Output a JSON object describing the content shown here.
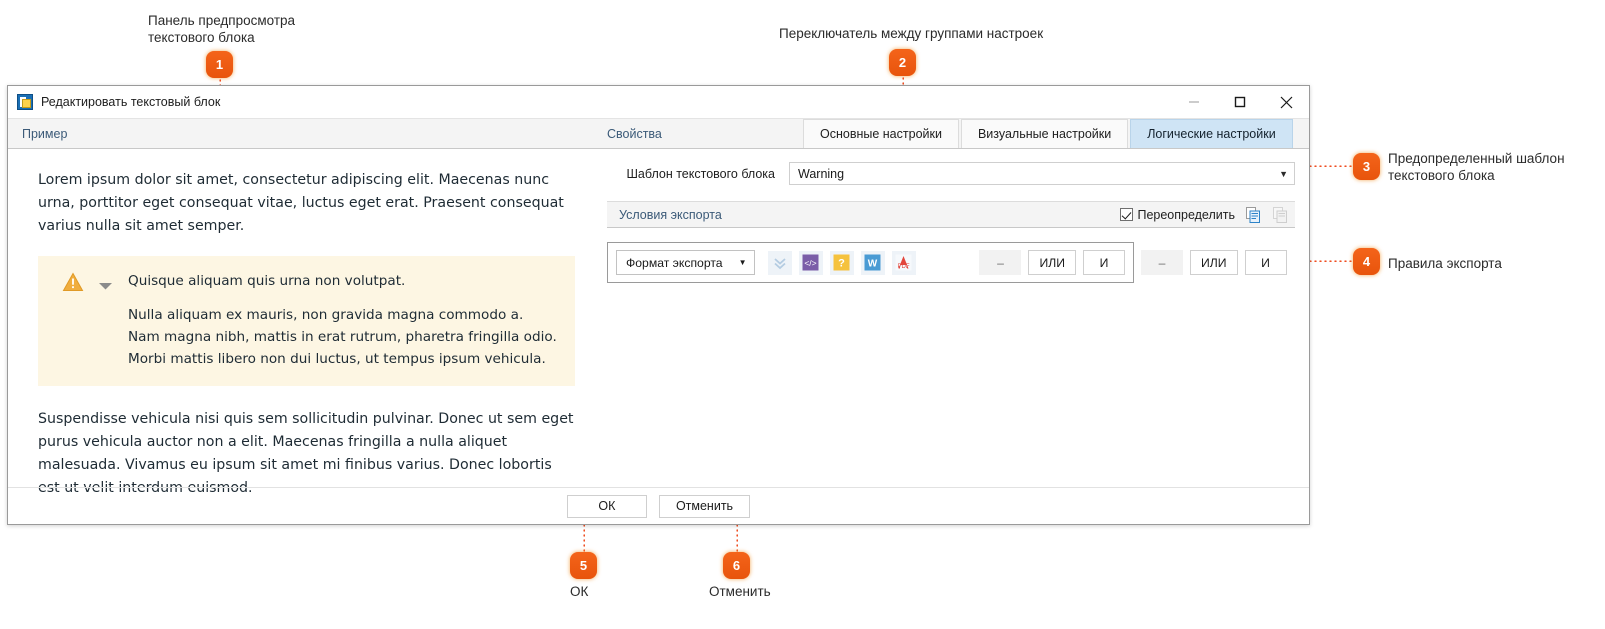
{
  "annotations": [
    {
      "n": "1",
      "label": "Панель предпросмотра\nтекстового блока"
    },
    {
      "n": "2",
      "label": "Переключатель между группами настроек"
    },
    {
      "n": "3",
      "label": "Предопределенный шаблон\nтекстового блока"
    },
    {
      "n": "4",
      "label": "Правила экспорта"
    },
    {
      "n": "5",
      "label": "ОК"
    },
    {
      "n": "6",
      "label": "Отменить"
    }
  ],
  "window": {
    "title": "Редактировать текстовый блок",
    "icon": "text-block-icon",
    "controls": {
      "minimize": "minimize-icon",
      "maximize": "maximize-icon",
      "close": "close-icon"
    }
  },
  "preview": {
    "header": "Пример",
    "paragraph1": "Lorem ipsum dolor sit amet, consectetur adipiscing elit. Maecenas nunc urna, porttitor eget consequat vitae, luctus eget erat. Praesent consequat varius nulla sit amet semper.",
    "callout": {
      "icon": "warning-triangle-icon",
      "toggle": "chevron-down-icon",
      "heading": "Quisque aliquam quis urna non volutpat.",
      "body": "Nulla aliquam ex mauris, non gravida magna commodo a. Nam magna nibh, mattis in erat rutrum, pharetra fringilla odio. Morbi mattis libero non dui luctus, ut tempus ipsum vehicula."
    },
    "paragraph2": "Suspendisse vehicula nisi quis sem sollicitudin pulvinar. Donec ut sem eget purus vehicula auctor non a elit. Maecenas fringilla a nulla aliquet malesuada. Vivamus eu ipsum sit amet mi finibus varius. Donec lobortis est ut velit interdum euismod."
  },
  "settings": {
    "panel_title": "Свойства",
    "tabs": [
      {
        "label": "Основные настройки",
        "active": false
      },
      {
        "label": "Визуальные настройки",
        "active": false
      },
      {
        "label": "Логические настройки",
        "active": true
      }
    ],
    "template_field": {
      "label": "Шаблон текстового блока",
      "value": "Warning",
      "caret": "chevron-down-icon"
    },
    "export_conditions": {
      "title": "Условия экспорта",
      "override_label": "Переопределить",
      "override_checked": true,
      "copy_icon": "copy-icon",
      "paste_icon": "paste-icon"
    },
    "rule_group": {
      "format_combo": {
        "label": "Формат экспорта",
        "caret": "chevron-down-icon"
      },
      "icons": [
        {
          "name": "double-chevron-down-icon",
          "glyph": "check"
        },
        {
          "name": "xml-export-icon",
          "glyph": "</>"
        },
        {
          "name": "help-export-icon",
          "glyph": "?"
        },
        {
          "name": "word-export-icon",
          "glyph": "W"
        },
        {
          "name": "pdf-export-icon",
          "glyph": "A"
        }
      ],
      "ops": [
        {
          "label": "–",
          "flat": true
        },
        {
          "label": "ИЛИ",
          "flat": false
        },
        {
          "label": "И",
          "flat": false
        }
      ]
    },
    "outer_ops": [
      {
        "label": "–",
        "flat": true
      },
      {
        "label": "ИЛИ",
        "flat": false
      },
      {
        "label": "И",
        "flat": false
      }
    ]
  },
  "footer": {
    "ok": "ОК",
    "cancel": "Отменить"
  },
  "colors": {
    "accent_orange": "#f05a14",
    "tab_active": "#cfe4f5",
    "callout_bg": "#fdf6e3",
    "link_blue": "#3b5a78"
  }
}
